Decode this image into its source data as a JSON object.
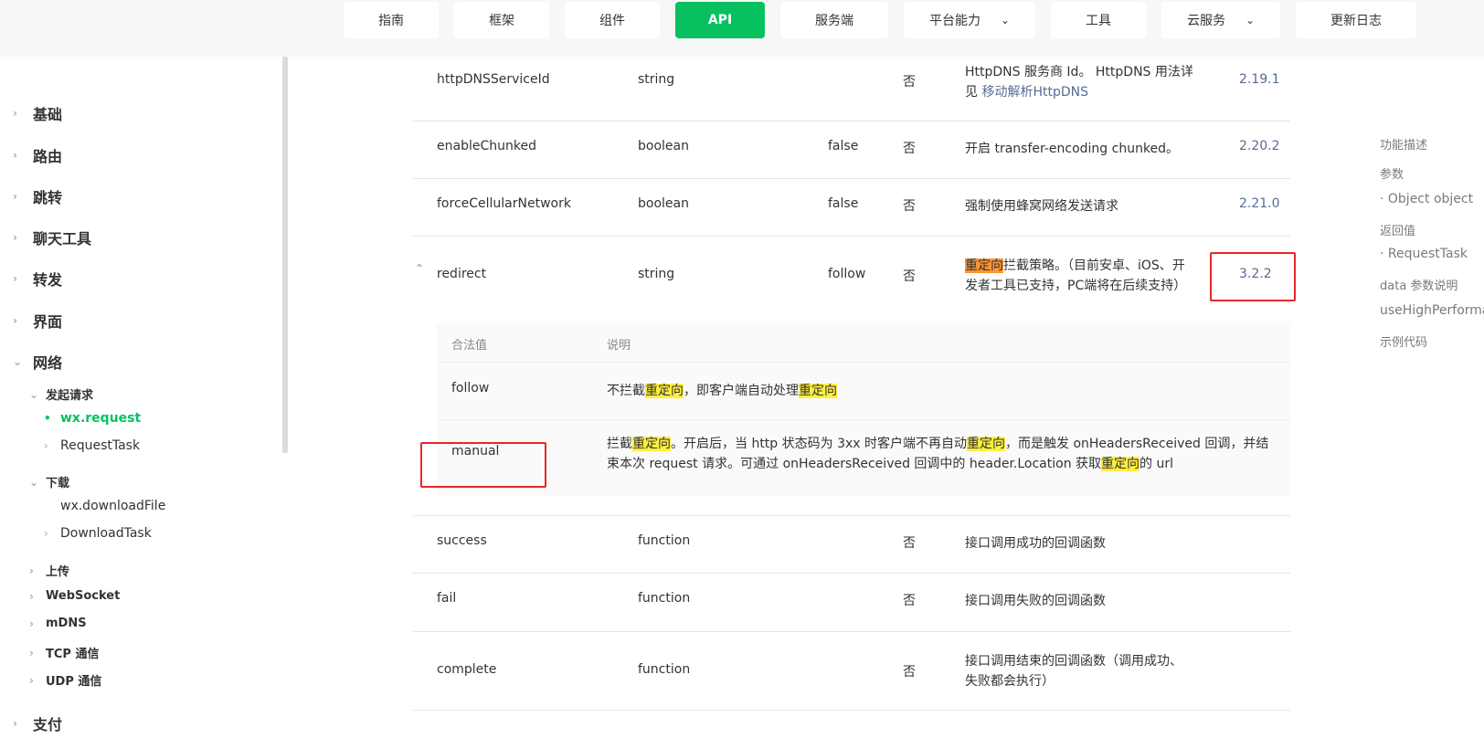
{
  "nav": {
    "tabs": [
      "指南",
      "框架",
      "组件",
      "API",
      "服务端",
      "平台能力",
      "工具",
      "云服务",
      "更新日志"
    ],
    "active": "API"
  },
  "sidebar": {
    "basics": "基础",
    "routing": "路由",
    "navigate": "跳转",
    "chat_tools": "聊天工具",
    "forward": "转发",
    "ui": "界面",
    "network": "网络",
    "initiate_request": "发起请求",
    "wx_request": "wx.request",
    "request_task": "RequestTask",
    "download": "下载",
    "wx_download_file": "wx.downloadFile",
    "download_task": "DownloadTask",
    "upload": "上传",
    "websocket": "WebSocket",
    "mdns": "mDNS",
    "tcp": "TCP 通信",
    "udp": "UDP 通信",
    "payment": "支付"
  },
  "table": {
    "rows": [
      {
        "name": "httpDNSServiceId",
        "type": "string",
        "default": "",
        "required": "否",
        "desc": "HttpDNS 服务商 Id。 HttpDNS 用法详见",
        "link": "移动解析HttpDNS",
        "version": "2.19.1"
      },
      {
        "name": "enableChunked",
        "type": "boolean",
        "default": "false",
        "required": "否",
        "desc": "开启 transfer-encoding chunked。",
        "version": "2.20.2"
      },
      {
        "name": "forceCellularNetwork",
        "type": "boolean",
        "default": "false",
        "required": "否",
        "desc": "强制使用蜂窝网络发送请求",
        "version": "2.21.0"
      },
      {
        "name": "redirect",
        "type": "string",
        "default": "follow",
        "required": "否",
        "desc_hl": "重定向",
        "desc": "拦截策略。（目前安卓、iOS、开发者工具已支持，PC端将在后续支持）",
        "version": "3.2.2"
      },
      {
        "name": "success",
        "type": "function",
        "default": "",
        "required": "否",
        "desc": "接口调用成功的回调函数",
        "version": ""
      },
      {
        "name": "fail",
        "type": "function",
        "default": "",
        "required": "否",
        "desc": "接口调用失败的回调函数",
        "version": ""
      },
      {
        "name": "complete",
        "type": "function",
        "default": "",
        "required": "否",
        "desc": "接口调用结束的回调函数（调用成功、失败都会执行）",
        "version": ""
      }
    ]
  },
  "subtable": {
    "head_value": "合法值",
    "head_desc": "说明",
    "follow": {
      "value": "follow",
      "p1": "不拦截",
      "hl1": "重定向",
      "p2": "，即客户端自动处理",
      "hl2": "重定向"
    },
    "manual": {
      "value": "manual",
      "p1": "拦截",
      "hl1": "重定向",
      "p2": "。开启后，当 http 状态码为 3xx 时客户端不再自动",
      "hl2": "重定向",
      "p3": "，而是触发 onHeadersReceived 回调，并结束本次 request 请求。可通过 onHeadersReceived 回调中的 header.Location 获取",
      "hl3": "重定向",
      "p4": "的 url"
    }
  },
  "toc": [
    "功能描述",
    "参数",
    "· Object object",
    "返回值",
    "· RequestTask",
    "data 参数说明",
    "useHighPerforma",
    "示例代码"
  ],
  "colors": {
    "accent": "#07c160",
    "link": "#576b95",
    "highlight": "#fff03e",
    "highlight_current": "#ff9632",
    "annotation": "#e8262a"
  }
}
